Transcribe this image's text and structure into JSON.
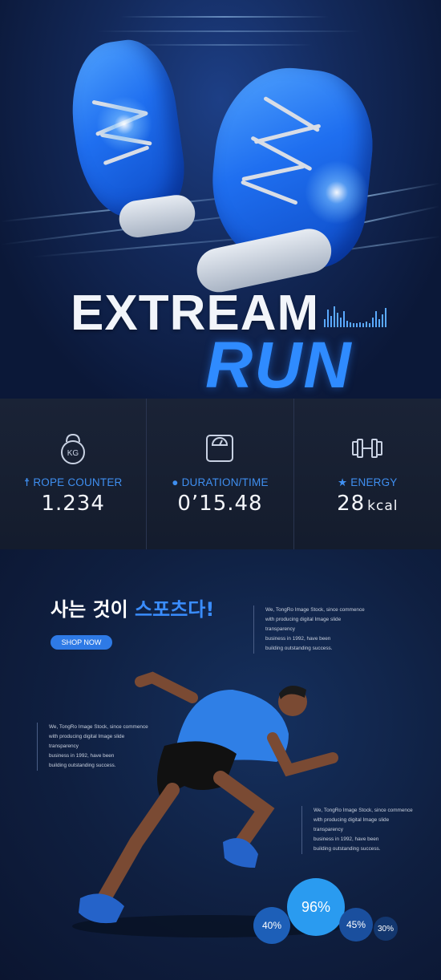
{
  "hero": {
    "title_line1": "EXTREAM",
    "title_line2": "RUN"
  },
  "stats": [
    {
      "icon": "kettlebell-icon",
      "icon_text": "KG",
      "label": "ROPE COUNTER",
      "label_icon": "runner-icon",
      "value": "1.234",
      "unit": ""
    },
    {
      "icon": "scale-icon",
      "label": "DURATION/TIME",
      "label_icon": "stopwatch-icon",
      "value": "0’15.48",
      "unit": ""
    },
    {
      "icon": "dumbbell-icon",
      "label": "ENERGY",
      "label_icon": "star-icon",
      "value": "28",
      "unit": "kcal"
    }
  ],
  "promo": {
    "headline_part1": "사는 것이 ",
    "headline_part2": "스포츠다!",
    "shop_button": "SHOP NOW"
  },
  "notes": [
    {
      "lines": [
        "We, TongRo Image Stock, since commence",
        "with producing digital Image slide transparency",
        "business in 1992, have been",
        "building outstanding success."
      ]
    },
    {
      "lines": [
        "We, TongRo Image Stock, since commence",
        "with producing digital Image slide transparency",
        "business in 1992, have been",
        "building outstanding success."
      ]
    },
    {
      "lines": [
        "We, TongRo Image Stock, since commence",
        "with producing digital Image slide transparency",
        "business in 1992, have been",
        "building outstanding success."
      ]
    }
  ],
  "percent_circles": [
    {
      "value": "40%",
      "color": "#1d5fb8"
    },
    {
      "value": "96%",
      "color": "#2a9bf0"
    },
    {
      "value": "45%",
      "color": "#1a4f9e"
    },
    {
      "value": "30%",
      "color": "#13376f"
    }
  ],
  "colors": {
    "accent": "#2f8bff",
    "stat_label": "#3f8ff0",
    "background": "#0d1a33"
  }
}
